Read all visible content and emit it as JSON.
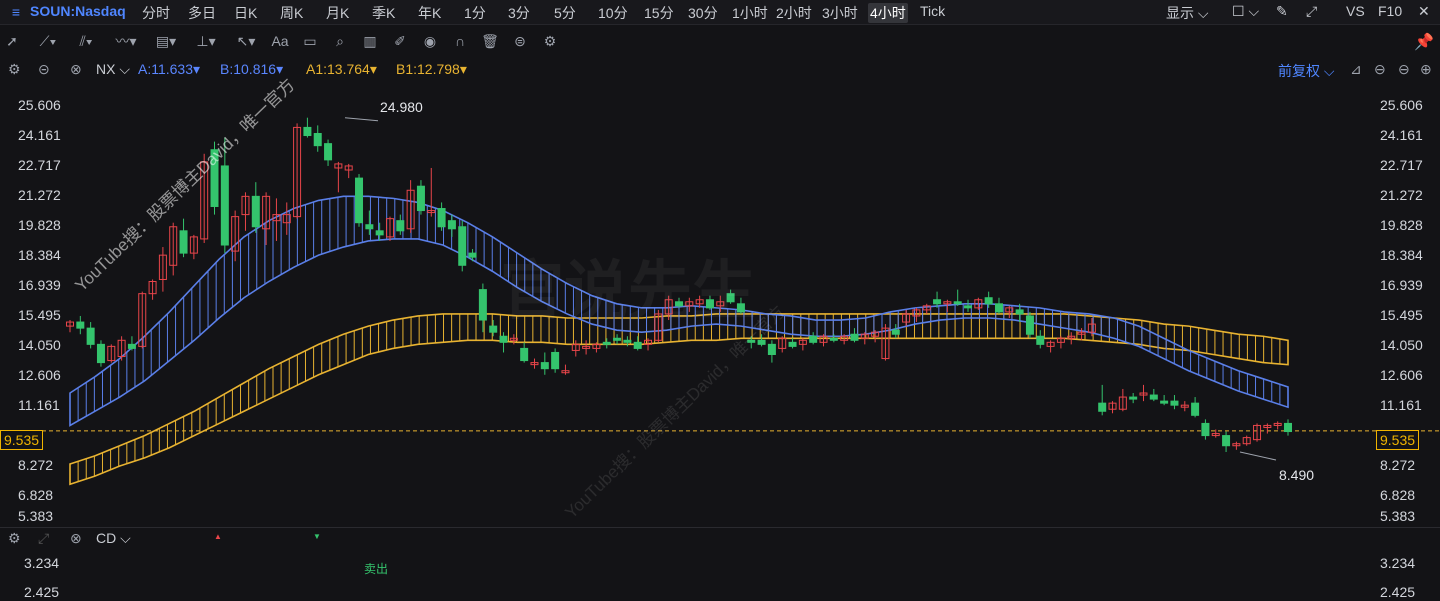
{
  "topbar": {
    "symbol": "SOUN:Nasdaq",
    "timeframes": [
      "分时",
      "多日",
      "日K",
      "周K",
      "月K",
      "季K",
      "年K",
      "1分",
      "3分",
      "5分",
      "10分",
      "15分",
      "30分",
      "1小时",
      "2小时",
      "3小时",
      "4小时",
      "Tick"
    ],
    "active_timeframe": "4小时",
    "display_label": "显示",
    "vs_label": "VS",
    "f10_label": "F10"
  },
  "indicator_row": {
    "name": "NX",
    "a_label": "A:11.633",
    "b_label": "B:10.816",
    "a1_label": "A1:13.764",
    "b1_label": "B1:12.798",
    "adjust_label": "前复权"
  },
  "price_axis": {
    "ticks": [
      "25.606",
      "24.161",
      "22.717",
      "21.272",
      "19.828",
      "18.384",
      "16.939",
      "15.495",
      "14.050",
      "12.606",
      "11.161",
      "9.535",
      "8.272",
      "6.828",
      "5.383"
    ],
    "current_price": "9.535"
  },
  "annotations": {
    "high": "24.980",
    "low": "8.490"
  },
  "watermark": {
    "text": "YouTube搜：股票博主David，唯一官方",
    "text2": "YouTube搜：股票博主David，唯一官方",
    "big": "官说先生"
  },
  "sub_panel": {
    "name": "CD",
    "ticks": [
      "3.234",
      "2.425"
    ],
    "sell_label": "卖出"
  },
  "colors": {
    "up": "#e8454a",
    "down": "#34c46d",
    "blue_band": "#5a7fe8",
    "yellow_band": "#e8b331",
    "accent": "#4f86ff"
  },
  "chart_data": {
    "type": "candlestick",
    "ylim": [
      5.383,
      25.606
    ],
    "candles": [
      {
        "o": 14.7,
        "h": 15.0,
        "l": 14.4,
        "c": 14.9
      },
      {
        "o": 14.9,
        "h": 15.2,
        "l": 14.3,
        "c": 14.6
      },
      {
        "o": 14.6,
        "h": 14.9,
        "l": 13.6,
        "c": 13.8
      },
      {
        "o": 13.8,
        "h": 14.0,
        "l": 12.7,
        "c": 12.9
      },
      {
        "o": 13.0,
        "h": 13.8,
        "l": 12.9,
        "c": 13.7
      },
      {
        "o": 13.2,
        "h": 14.2,
        "l": 13.0,
        "c": 14.0
      },
      {
        "o": 13.8,
        "h": 14.2,
        "l": 13.5,
        "c": 13.6
      },
      {
        "o": 13.7,
        "h": 16.4,
        "l": 13.6,
        "c": 16.3
      },
      {
        "o": 16.3,
        "h": 17.0,
        "l": 16.0,
        "c": 16.9
      },
      {
        "o": 17.0,
        "h": 18.6,
        "l": 16.4,
        "c": 18.2
      },
      {
        "o": 17.7,
        "h": 19.8,
        "l": 17.2,
        "c": 19.6
      },
      {
        "o": 19.4,
        "h": 20.0,
        "l": 18.1,
        "c": 18.3
      },
      {
        "o": 18.3,
        "h": 19.2,
        "l": 18.0,
        "c": 19.1
      },
      {
        "o": 19.0,
        "h": 23.2,
        "l": 18.8,
        "c": 22.8
      },
      {
        "o": 23.4,
        "h": 23.8,
        "l": 20.2,
        "c": 20.6
      },
      {
        "o": 22.6,
        "h": 24.0,
        "l": 18.3,
        "c": 18.7
      },
      {
        "o": 18.4,
        "h": 20.4,
        "l": 17.9,
        "c": 20.1
      },
      {
        "o": 20.2,
        "h": 21.3,
        "l": 19.4,
        "c": 21.1
      },
      {
        "o": 21.1,
        "h": 21.8,
        "l": 19.3,
        "c": 19.6
      },
      {
        "o": 19.5,
        "h": 21.3,
        "l": 18.7,
        "c": 21.1
      },
      {
        "o": 19.9,
        "h": 21.0,
        "l": 18.9,
        "c": 20.2
      },
      {
        "o": 19.8,
        "h": 20.8,
        "l": 19.2,
        "c": 20.2
      },
      {
        "o": 20.1,
        "h": 24.7,
        "l": 20.0,
        "c": 24.5
      },
      {
        "o": 24.5,
        "h": 24.98,
        "l": 24.0,
        "c": 24.1
      },
      {
        "o": 24.2,
        "h": 24.6,
        "l": 23.3,
        "c": 23.6
      },
      {
        "o": 23.7,
        "h": 23.9,
        "l": 22.6,
        "c": 22.9
      },
      {
        "o": 22.5,
        "h": 22.8,
        "l": 21.3,
        "c": 22.7
      },
      {
        "o": 22.4,
        "h": 22.7,
        "l": 22.0,
        "c": 22.6
      },
      {
        "o": 22.0,
        "h": 22.2,
        "l": 19.6,
        "c": 19.8
      },
      {
        "o": 19.7,
        "h": 20.4,
        "l": 19.2,
        "c": 19.5
      },
      {
        "o": 19.4,
        "h": 19.8,
        "l": 18.9,
        "c": 19.2
      },
      {
        "o": 19.1,
        "h": 20.1,
        "l": 18.9,
        "c": 20.0
      },
      {
        "o": 19.9,
        "h": 20.2,
        "l": 19.2,
        "c": 19.4
      },
      {
        "o": 19.5,
        "h": 21.9,
        "l": 19.3,
        "c": 21.4
      },
      {
        "o": 21.6,
        "h": 21.9,
        "l": 20.2,
        "c": 20.4
      },
      {
        "o": 20.3,
        "h": 22.5,
        "l": 20.1,
        "c": 20.4
      },
      {
        "o": 20.5,
        "h": 20.8,
        "l": 19.4,
        "c": 19.6
      },
      {
        "o": 19.9,
        "h": 20.2,
        "l": 19.1,
        "c": 19.5
      },
      {
        "o": 19.6,
        "h": 19.9,
        "l": 17.4,
        "c": 17.7
      },
      {
        "o": 18.3,
        "h": 18.5,
        "l": 17.9,
        "c": 18.1
      },
      {
        "o": 16.5,
        "h": 16.8,
        "l": 14.4,
        "c": 15.0
      },
      {
        "o": 14.7,
        "h": 15.0,
        "l": 14.2,
        "c": 14.4
      },
      {
        "o": 14.2,
        "h": 14.4,
        "l": 13.4,
        "c": 13.9
      },
      {
        "o": 14.0,
        "h": 14.3,
        "l": 13.8,
        "c": 14.1
      },
      {
        "o": 13.6,
        "h": 13.9,
        "l": 12.9,
        "c": 13.0
      },
      {
        "o": 12.8,
        "h": 13.1,
        "l": 12.6,
        "c": 12.9
      },
      {
        "o": 12.9,
        "h": 13.4,
        "l": 12.3,
        "c": 12.6
      },
      {
        "o": 13.4,
        "h": 13.6,
        "l": 12.4,
        "c": 12.6
      },
      {
        "o": 12.5,
        "h": 12.8,
        "l": 12.3,
        "c": 12.5
      },
      {
        "o": 13.5,
        "h": 14.0,
        "l": 13.2,
        "c": 13.8
      },
      {
        "o": 13.6,
        "h": 14.0,
        "l": 13.3,
        "c": 13.7
      },
      {
        "o": 13.6,
        "h": 13.9,
        "l": 13.4,
        "c": 13.8
      },
      {
        "o": 13.9,
        "h": 14.1,
        "l": 13.6,
        "c": 13.8
      },
      {
        "o": 14.1,
        "h": 14.3,
        "l": 13.8,
        "c": 14.0
      },
      {
        "o": 14.0,
        "h": 14.2,
        "l": 13.7,
        "c": 13.9
      },
      {
        "o": 13.9,
        "h": 14.2,
        "l": 13.5,
        "c": 13.6
      },
      {
        "o": 13.8,
        "h": 14.1,
        "l": 13.5,
        "c": 14.0
      },
      {
        "o": 14.0,
        "h": 15.5,
        "l": 13.9,
        "c": 15.3
      },
      {
        "o": 15.3,
        "h": 16.2,
        "l": 15.0,
        "c": 16.0
      },
      {
        "o": 15.9,
        "h": 16.1,
        "l": 15.6,
        "c": 15.7
      },
      {
        "o": 15.7,
        "h": 16.1,
        "l": 15.4,
        "c": 15.9
      },
      {
        "o": 15.8,
        "h": 16.2,
        "l": 15.6,
        "c": 16.0
      },
      {
        "o": 16.0,
        "h": 16.2,
        "l": 15.5,
        "c": 15.6
      },
      {
        "o": 15.7,
        "h": 16.2,
        "l": 15.4,
        "c": 15.9
      },
      {
        "o": 16.3,
        "h": 16.5,
        "l": 15.8,
        "c": 15.9
      },
      {
        "o": 15.8,
        "h": 16.1,
        "l": 15.3,
        "c": 15.4
      },
      {
        "o": 14.0,
        "h": 14.2,
        "l": 13.6,
        "c": 13.9
      },
      {
        "o": 14.0,
        "h": 14.3,
        "l": 13.7,
        "c": 13.8
      },
      {
        "o": 13.8,
        "h": 14.0,
        "l": 12.9,
        "c": 13.3
      },
      {
        "o": 13.6,
        "h": 14.2,
        "l": 13.4,
        "c": 14.1
      },
      {
        "o": 13.9,
        "h": 14.1,
        "l": 13.6,
        "c": 13.7
      },
      {
        "o": 13.8,
        "h": 14.1,
        "l": 13.5,
        "c": 14.0
      },
      {
        "o": 14.2,
        "h": 14.4,
        "l": 13.8,
        "c": 13.9
      },
      {
        "o": 13.9,
        "h": 14.3,
        "l": 13.7,
        "c": 14.2
      },
      {
        "o": 14.1,
        "h": 14.3,
        "l": 13.9,
        "c": 14.0
      },
      {
        "o": 14.0,
        "h": 14.3,
        "l": 13.8,
        "c": 14.2
      },
      {
        "o": 14.3,
        "h": 14.6,
        "l": 13.9,
        "c": 14.0
      },
      {
        "o": 14.1,
        "h": 14.4,
        "l": 13.8,
        "c": 14.3
      },
      {
        "o": 14.2,
        "h": 14.5,
        "l": 13.9,
        "c": 14.4
      },
      {
        "o": 13.1,
        "h": 14.8,
        "l": 13.0,
        "c": 14.6
      },
      {
        "o": 14.5,
        "h": 14.8,
        "l": 14.1,
        "c": 14.3
      },
      {
        "o": 14.9,
        "h": 15.5,
        "l": 14.7,
        "c": 15.3
      },
      {
        "o": 15.2,
        "h": 15.6,
        "l": 14.9,
        "c": 15.5
      },
      {
        "o": 15.5,
        "h": 15.8,
        "l": 15.3,
        "c": 15.7
      },
      {
        "o": 16.0,
        "h": 16.4,
        "l": 15.6,
        "c": 15.8
      },
      {
        "o": 15.8,
        "h": 16.0,
        "l": 15.4,
        "c": 15.9
      },
      {
        "o": 15.9,
        "h": 16.5,
        "l": 15.7,
        "c": 15.8
      },
      {
        "o": 15.7,
        "h": 16.0,
        "l": 15.4,
        "c": 15.6
      },
      {
        "o": 15.6,
        "h": 16.1,
        "l": 15.5,
        "c": 16.0
      },
      {
        "o": 16.1,
        "h": 16.4,
        "l": 15.6,
        "c": 15.8
      },
      {
        "o": 15.8,
        "h": 16.1,
        "l": 15.3,
        "c": 15.4
      },
      {
        "o": 15.4,
        "h": 15.7,
        "l": 15.1,
        "c": 15.6
      },
      {
        "o": 15.5,
        "h": 15.8,
        "l": 14.9,
        "c": 15.3
      },
      {
        "o": 15.2,
        "h": 15.4,
        "l": 14.1,
        "c": 14.3
      },
      {
        "o": 14.2,
        "h": 14.5,
        "l": 13.6,
        "c": 13.8
      },
      {
        "o": 13.7,
        "h": 14.0,
        "l": 13.4,
        "c": 13.9
      },
      {
        "o": 13.9,
        "h": 14.2,
        "l": 13.6,
        "c": 14.1
      },
      {
        "o": 14.1,
        "h": 14.4,
        "l": 13.8,
        "c": 14.2
      },
      {
        "o": 14.3,
        "h": 14.6,
        "l": 14.0,
        "c": 14.4
      },
      {
        "o": 14.4,
        "h": 15.1,
        "l": 14.2,
        "c": 14.8
      },
      {
        "o": 10.9,
        "h": 11.8,
        "l": 10.3,
        "c": 10.5
      },
      {
        "o": 10.6,
        "h": 11.0,
        "l": 10.4,
        "c": 10.9
      },
      {
        "o": 10.6,
        "h": 11.6,
        "l": 10.5,
        "c": 11.2
      },
      {
        "o": 11.2,
        "h": 11.4,
        "l": 10.9,
        "c": 11.1
      },
      {
        "o": 11.3,
        "h": 11.8,
        "l": 11.0,
        "c": 11.4
      },
      {
        "o": 11.3,
        "h": 11.6,
        "l": 11.0,
        "c": 11.1
      },
      {
        "o": 11.0,
        "h": 11.3,
        "l": 10.8,
        "c": 10.9
      },
      {
        "o": 11.0,
        "h": 11.3,
        "l": 10.6,
        "c": 10.8
      },
      {
        "o": 10.7,
        "h": 11.0,
        "l": 10.5,
        "c": 10.8
      },
      {
        "o": 10.9,
        "h": 11.2,
        "l": 10.2,
        "c": 10.3
      },
      {
        "o": 9.9,
        "h": 10.1,
        "l": 9.1,
        "c": 9.3
      },
      {
        "o": 9.4,
        "h": 9.6,
        "l": 9.2,
        "c": 9.4
      },
      {
        "o": 9.3,
        "h": 9.5,
        "l": 8.49,
        "c": 8.8
      },
      {
        "o": 8.8,
        "h": 9.0,
        "l": 8.6,
        "c": 8.9
      },
      {
        "o": 8.9,
        "h": 9.3,
        "l": 8.8,
        "c": 9.2
      },
      {
        "o": 9.1,
        "h": 9.9,
        "l": 9.0,
        "c": 9.8
      },
      {
        "o": 9.7,
        "h": 9.9,
        "l": 9.4,
        "c": 9.8
      },
      {
        "o": 9.8,
        "h": 10.0,
        "l": 9.6,
        "c": 9.9
      },
      {
        "o": 9.9,
        "h": 10.1,
        "l": 9.3,
        "c": 9.5
      }
    ],
    "blue_band": {
      "upper": [
        11.4,
        12.2,
        13.1,
        14.2,
        15.4,
        16.7,
        18.0,
        19.1,
        19.9,
        20.5,
        20.9,
        21.1,
        21.1,
        21.0,
        20.8,
        20.4,
        19.8,
        19.1,
        18.3,
        17.5,
        16.8,
        16.2,
        15.8,
        15.6,
        15.6,
        15.7,
        15.6,
        15.5,
        15.3,
        15.2,
        15.0,
        15.0,
        15.1,
        15.4,
        15.6,
        15.7,
        15.8,
        15.8,
        15.7,
        15.6,
        15.4,
        15.3,
        15.1,
        14.7,
        14.1,
        13.5,
        13.0,
        12.5,
        12.1,
        11.7
      ],
      "lower": [
        9.8,
        10.5,
        11.2,
        12.0,
        13.0,
        14.0,
        15.1,
        16.1,
        16.9,
        17.6,
        18.2,
        18.6,
        18.9,
        19.0,
        19.0,
        18.7,
        18.1,
        17.4,
        16.6,
        15.9,
        15.3,
        14.8,
        14.5,
        14.4,
        14.5,
        14.7,
        14.8,
        14.7,
        14.5,
        14.3,
        14.2,
        14.2,
        14.3,
        14.5,
        14.8,
        15.0,
        15.1,
        15.1,
        15.0,
        14.8,
        14.6,
        14.4,
        14.1,
        13.7,
        13.1,
        12.5,
        12.0,
        11.5,
        11.1,
        10.7
      ]
    },
    "yellow_band": {
      "upper": [
        7.9,
        8.3,
        8.8,
        9.3,
        9.9,
        10.5,
        11.2,
        11.9,
        12.6,
        13.2,
        13.8,
        14.3,
        14.7,
        15.0,
        15.2,
        15.3,
        15.3,
        15.3,
        15.2,
        15.2,
        15.1,
        15.1,
        15.1,
        15.1,
        15.2,
        15.2,
        15.3,
        15.3,
        15.3,
        15.3,
        15.3,
        15.3,
        15.3,
        15.3,
        15.3,
        15.3,
        15.3,
        15.3,
        15.3,
        15.3,
        15.3,
        15.2,
        15.1,
        15.0,
        14.8,
        14.7,
        14.5,
        14.3,
        14.2,
        14.0
      ],
      "lower": [
        6.9,
        7.3,
        7.8,
        8.2,
        8.7,
        9.3,
        9.9,
        10.5,
        11.1,
        11.7,
        12.3,
        12.8,
        13.3,
        13.6,
        13.8,
        13.9,
        14.0,
        14.0,
        13.9,
        13.9,
        13.8,
        13.8,
        13.8,
        13.8,
        13.9,
        14.0,
        14.0,
        14.1,
        14.1,
        14.1,
        14.1,
        14.1,
        14.1,
        14.1,
        14.1,
        14.1,
        14.1,
        14.1,
        14.1,
        14.1,
        14.1,
        14.0,
        13.9,
        13.8,
        13.6,
        13.5,
        13.3,
        13.1,
        12.9,
        12.8
      ]
    }
  }
}
